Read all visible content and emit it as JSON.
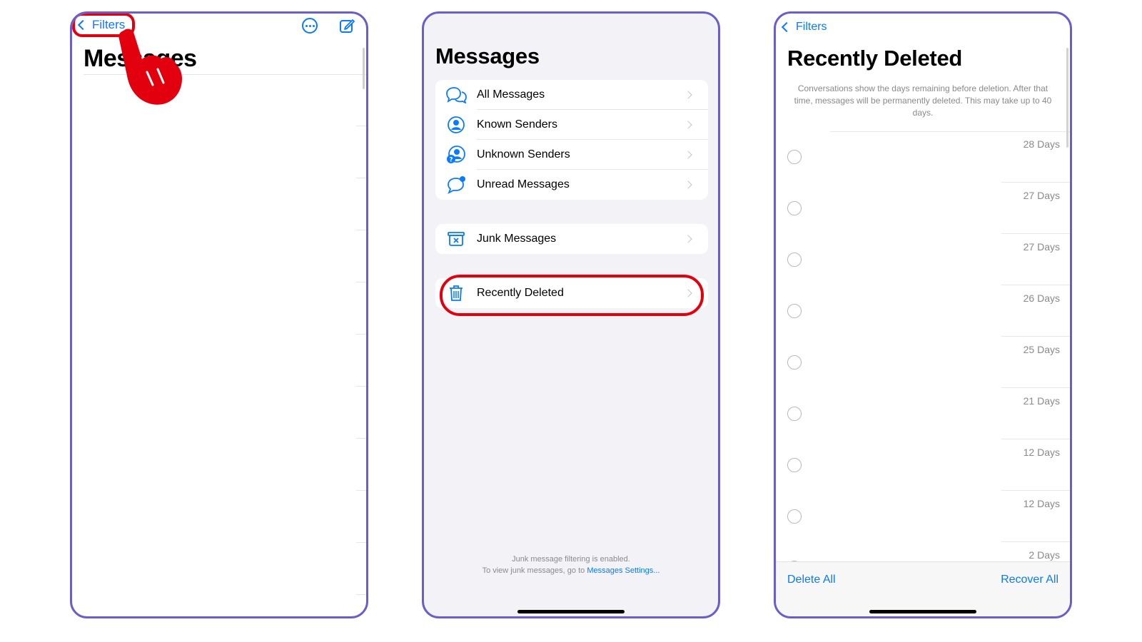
{
  "panel1": {
    "back_label": "Filters",
    "title": "Messages",
    "icons": [
      "chevron-left-icon",
      "more-circle-icon",
      "compose-icon",
      "pointing-hand-icon"
    ]
  },
  "panel2": {
    "title": "Messages",
    "filters": [
      {
        "label": "All Messages",
        "icon": "bubbles-icon"
      },
      {
        "label": "Known Senders",
        "icon": "person-circle-icon"
      },
      {
        "label": "Unknown Senders",
        "icon": "person-question-icon"
      },
      {
        "label": "Unread Messages",
        "icon": "bubble-badge-icon"
      }
    ],
    "junk": {
      "label": "Junk Messages",
      "icon": "junk-bin-icon"
    },
    "recently_deleted": {
      "label": "Recently Deleted",
      "icon": "trash-icon"
    },
    "footer_line1": "Junk message filtering is enabled.",
    "footer_line2_prefix": "To view junk messages, go to ",
    "footer_link": "Messages Settings..."
  },
  "panel3": {
    "back_label": "Filters",
    "title": "Recently Deleted",
    "description": "Conversations show the days remaining before deletion. After that time, messages will be permanently deleted. This may take up to 40 days.",
    "rows": [
      {
        "days": "28 Days"
      },
      {
        "days": "27 Days"
      },
      {
        "days": "27 Days"
      },
      {
        "days": "26 Days"
      },
      {
        "days": "25 Days"
      },
      {
        "days": "21 Days"
      },
      {
        "days": "12 Days"
      },
      {
        "days": "12 Days"
      },
      {
        "days": "2 Days"
      }
    ],
    "delete_all_label": "Delete All",
    "recover_all_label": "Recover All"
  },
  "colors": {
    "accent": "#0a7aff",
    "highlight": "#e3000e",
    "frame": "#6a5fc8",
    "grouped_background": "#f2f2f7"
  }
}
